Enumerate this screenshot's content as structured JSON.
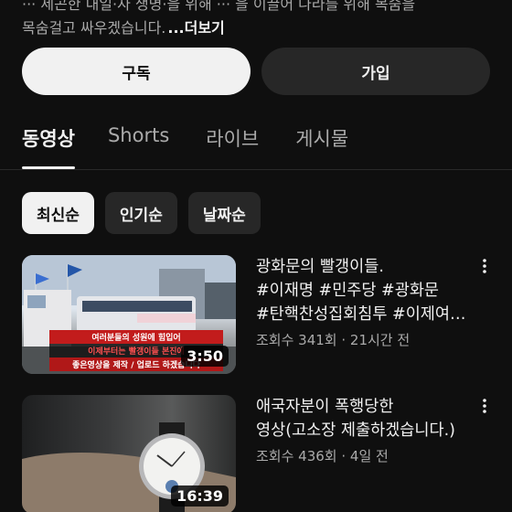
{
  "channel": {
    "description_partial": "··· 세곤한 내일·자 생명·을 위해 ··· 을 이끌어 나라를 위해 목숨을",
    "description_line2": "목숨걸고 싸우겠습니다.",
    "more_label": "...더보기"
  },
  "actions": {
    "subscribe_label": "구독",
    "join_label": "가입"
  },
  "tabs": [
    {
      "label": "동영상",
      "active": true
    },
    {
      "label": "Shorts",
      "active": false
    },
    {
      "label": "라이브",
      "active": false
    },
    {
      "label": "게시물",
      "active": false
    }
  ],
  "sort_chips": [
    {
      "label": "최신순",
      "selected": true
    },
    {
      "label": "인기순",
      "selected": false
    },
    {
      "label": "날짜순",
      "selected": false
    }
  ],
  "videos": [
    {
      "title_line1": "광화문의 빨갱이들.",
      "title_line2": "#이재명 #민주당 #광화문",
      "title_line3": "#탄핵찬성집회침투 #이제여…",
      "stats": "조회수 341회 · 21시간 전",
      "duration": "3:50",
      "thumb_caption_1": "여러분들의 성원에 힘입어",
      "thumb_caption_2": "이제부터는 빨갱이들 본진에",
      "thumb_caption_3": "좋은영상을 제작 / 업로드 하겠습니다",
      "thumb_banner": "내란수괴 윤석열을 체포하라"
    },
    {
      "title_line1": "애국자분이 폭행당한",
      "title_line2": "영상(고소장 제출하겠습니다.)",
      "stats": "조회수 436회 · 4일 전",
      "duration": "16:39"
    }
  ],
  "icons": {
    "menu": "kebab-menu-icon"
  },
  "colors": {
    "background": "#0f0f0f",
    "subscribe_bg": "#f1f1f1",
    "chip_bg": "#272727",
    "secondary_text": "#aaaaaa"
  }
}
